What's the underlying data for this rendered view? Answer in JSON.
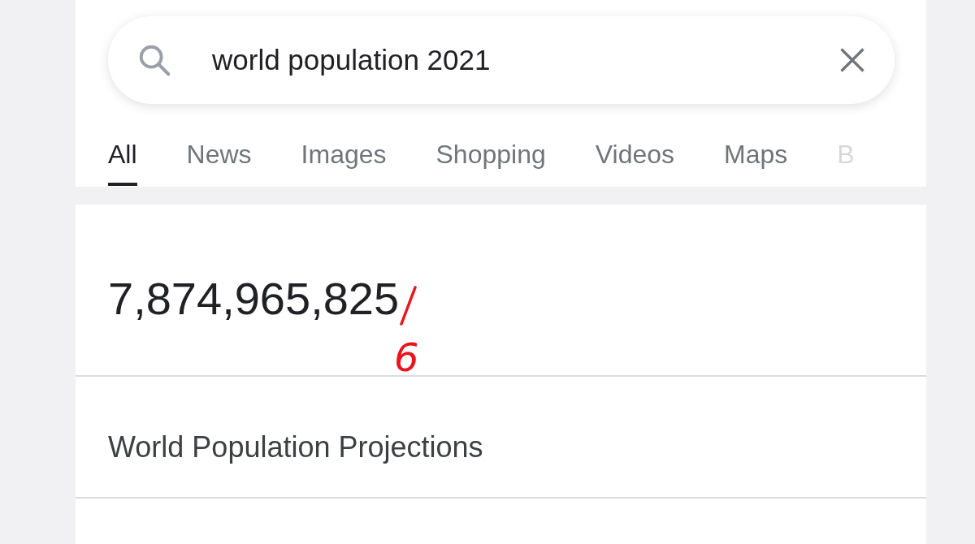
{
  "search": {
    "value": "world population 2021"
  },
  "tabs": [
    {
      "label": "All",
      "selected": true
    },
    {
      "label": "News",
      "selected": false
    },
    {
      "label": "Images",
      "selected": false
    },
    {
      "label": "Shopping",
      "selected": false
    },
    {
      "label": "Videos",
      "selected": false
    },
    {
      "label": "Maps",
      "selected": false
    },
    {
      "label": "B",
      "selected": false
    }
  ],
  "result": {
    "value": "7,874,965,825",
    "correction": "6"
  },
  "sections": [
    {
      "title": "World Population Projections"
    }
  ]
}
